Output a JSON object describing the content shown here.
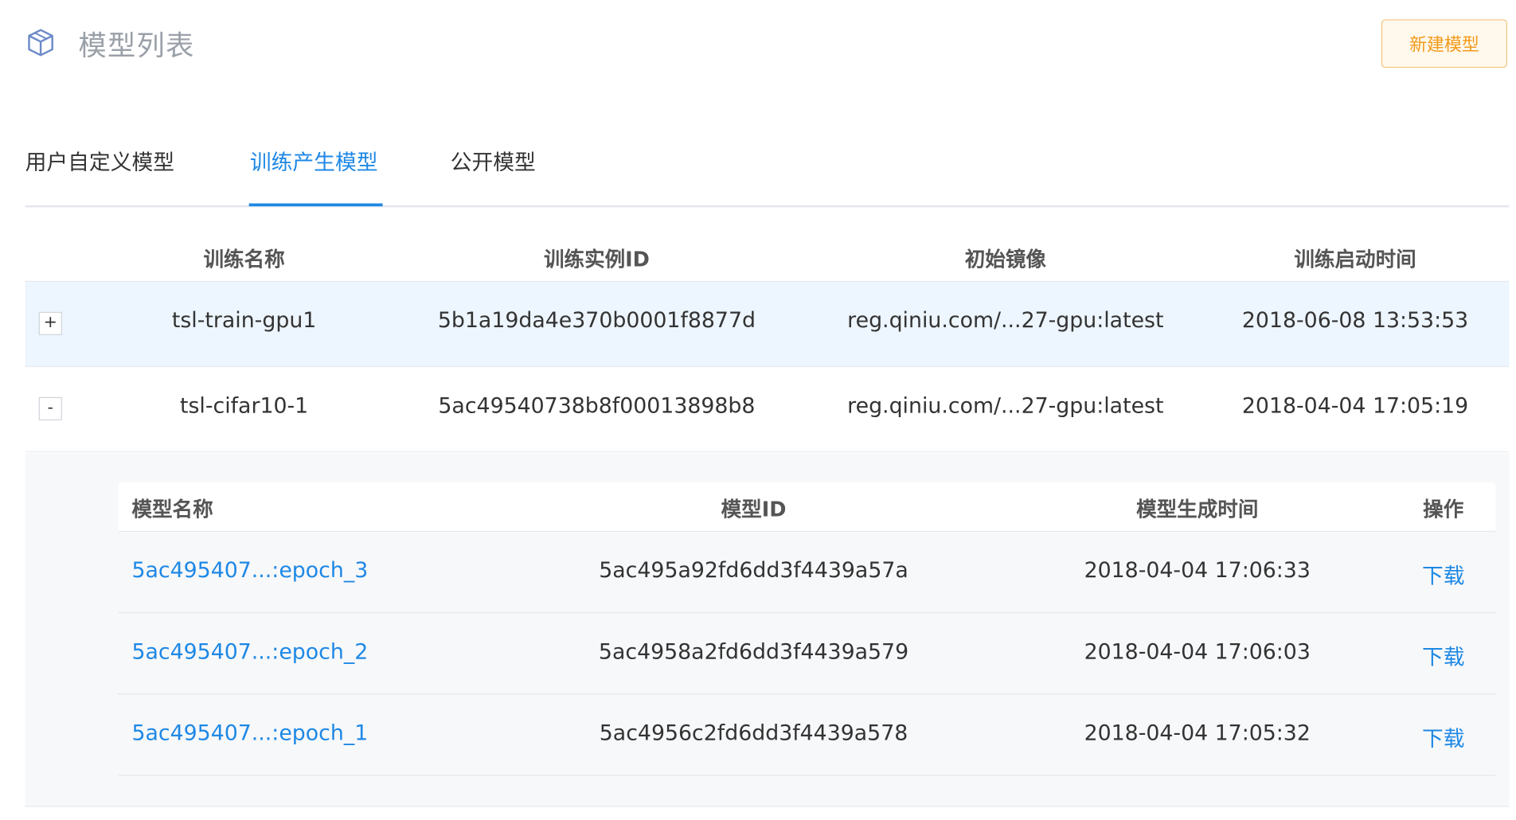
{
  "header": {
    "title": "模型列表",
    "icon": "cube-icon",
    "new_button_label": "新建模型"
  },
  "tabs": [
    {
      "label": "用户自定义模型",
      "active": false
    },
    {
      "label": "训练产生模型",
      "active": true
    },
    {
      "label": "公开模型",
      "active": false
    }
  ],
  "training_table": {
    "columns": [
      "训练名称",
      "训练实例ID",
      "初始镜像",
      "训练启动时间"
    ],
    "rows": [
      {
        "toggle": "+",
        "name": "tsl-train-gpu1",
        "instance_id": "5b1a19da4e370b0001f8877d",
        "image": "reg.qiniu.com/...27-gpu:latest",
        "start_time": "2018-06-08 13:53:53"
      },
      {
        "toggle": "-",
        "name": "tsl-cifar10-1",
        "instance_id": "5ac49540738b8f00013898b8",
        "image": "reg.qiniu.com/...27-gpu:latest",
        "start_time": "2018-04-04 17:05:19"
      }
    ]
  },
  "models_table": {
    "columns": [
      "模型名称",
      "模型ID",
      "模型生成时间",
      "操作"
    ],
    "rows": [
      {
        "name": "5ac495407...:epoch_3",
        "model_id": "5ac495a92fd6dd3f4439a57a",
        "created": "2018-04-04 17:06:33",
        "action": "下载"
      },
      {
        "name": "5ac495407...:epoch_2",
        "model_id": "5ac4958a2fd6dd3f4439a579",
        "created": "2018-04-04 17:06:03",
        "action": "下载"
      },
      {
        "name": "5ac495407...:epoch_1",
        "model_id": "5ac4956c2fd6dd3f4439a578",
        "created": "2018-04-04 17:05:32",
        "action": "下载"
      }
    ]
  },
  "colors": {
    "accent": "#1e88e5",
    "button_text": "#f29a1a",
    "button_border": "#f3c47e",
    "row_highlight": "#edf5fe"
  }
}
